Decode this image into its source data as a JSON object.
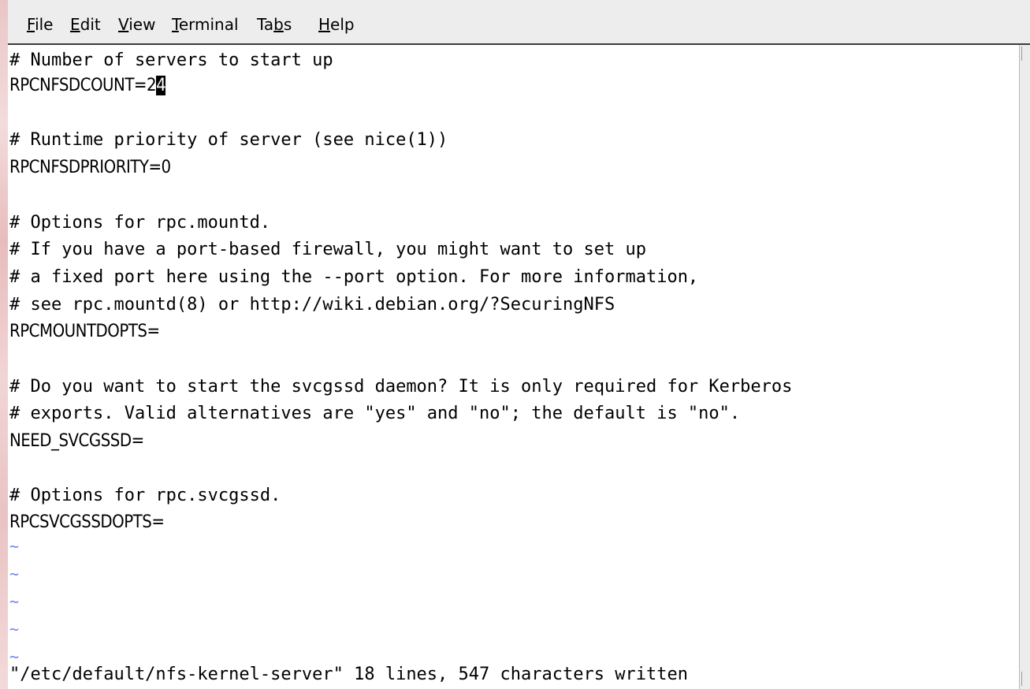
{
  "menubar": {
    "items": [
      {
        "label": "File",
        "mnemonic": "F"
      },
      {
        "label": "Edit",
        "mnemonic": "E"
      },
      {
        "label": "View",
        "mnemonic": "V"
      },
      {
        "label": "Terminal",
        "mnemonic": "T"
      },
      {
        "label": "Tabs",
        "mnemonic": "b"
      },
      {
        "label": "Help",
        "mnemonic": "H"
      }
    ]
  },
  "editor": {
    "lines": [
      "# Number of servers to start up",
      "RPCNFSDCOUNT=2",
      "",
      "# Runtime priority of server (see nice(1))",
      "RPCNFSDPRIORITY=0",
      "",
      "# Options for rpc.mountd.",
      "# If you have a port-based firewall, you might want to set up",
      "# a fixed port here using the --port option. For more information,",
      "# see rpc.mountd(8) or http://wiki.debian.org/?SecuringNFS",
      "RPCMOUNTDOPTS=",
      "",
      "# Do you want to start the svcgssd daemon? It is only required for Kerberos",
      "# exports. Valid alternatives are \"yes\" and \"no\"; the default is \"no\".",
      "NEED_SVCGSSD=",
      "",
      "# Options for rpc.svcgssd.",
      "RPCSVCGSSDOPTS="
    ],
    "cursor_char": "4",
    "empty_line_marker": "~",
    "status_line": "\"/etc/default/nfs-kernel-server\" 18 lines, 547 characters written"
  },
  "colors": {
    "menubar_bg": "#ededed",
    "tilde": "#6f86e8",
    "cursor_bg": "#000000",
    "text": "#000000"
  }
}
